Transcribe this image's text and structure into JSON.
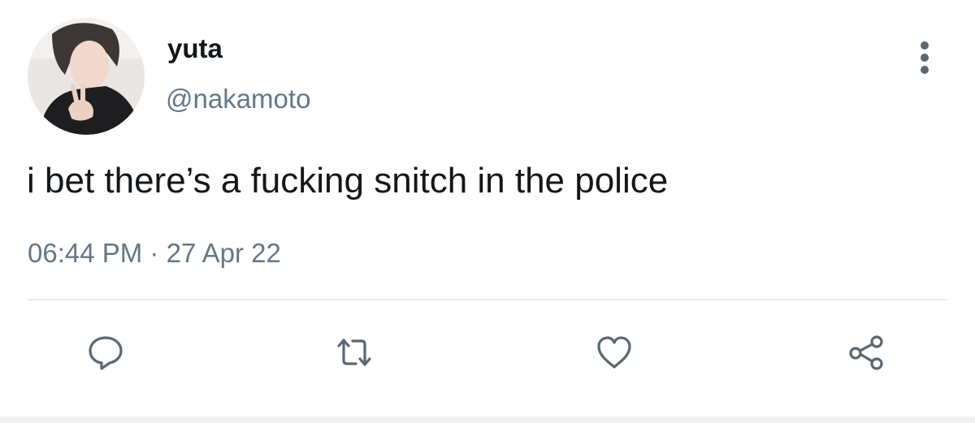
{
  "tweet": {
    "author": {
      "display_name": "yuta",
      "handle": "@nakamoto",
      "avatar_icon": "profile-photo"
    },
    "text": "i bet there’s a fucking snitch in the police",
    "time": "06:44 PM",
    "separator": "·",
    "date": "27 Apr 22"
  },
  "actions": {
    "reply_icon": "speech-bubble-icon",
    "retweet_icon": "retweet-arrows-icon",
    "like_icon": "heart-icon",
    "share_icon": "share-nodes-icon",
    "more_icon": "vertical-dots-icon"
  },
  "colors": {
    "text": "#14171a",
    "secondary": "#657786",
    "divider": "#e6ecf0",
    "background": "#ffffff"
  }
}
